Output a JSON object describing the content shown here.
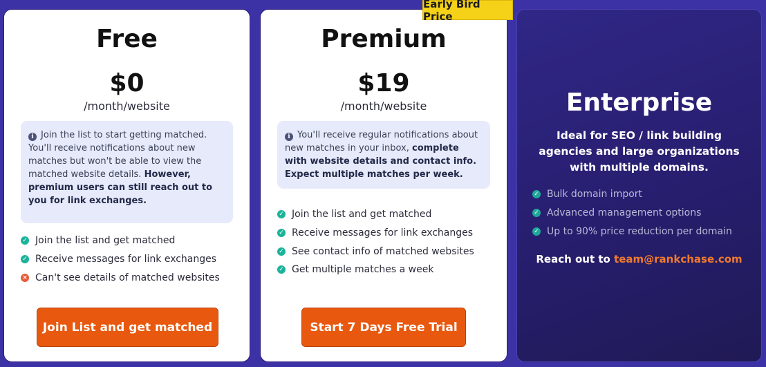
{
  "free": {
    "title": "Free",
    "price": "$0",
    "period": "/month/website",
    "info_normal": "Join the list to start getting matched. You'll receive notifications about new matches but won't be able to view the matched website details. ",
    "info_bold": "However, premium users can still reach out to you for link exchanges.",
    "features": [
      {
        "label": "Join the list and get matched",
        "status": "check"
      },
      {
        "label": "Receive messages for link exchanges",
        "status": "check"
      },
      {
        "label": "Can't see details of matched websites",
        "status": "cross"
      }
    ],
    "cta": "Join List and get matched"
  },
  "premium": {
    "badge": "Early Bird Price",
    "title": "Premium",
    "price": "$19",
    "period": "/month/website",
    "info_normal": "You'll receive regular notifications about new matches in your inbox, ",
    "info_bold": "complete with website details and contact info. Expect multiple matches per week.",
    "features": [
      {
        "label": "Join the list and get matched",
        "status": "check"
      },
      {
        "label": "Receive messages for link exchanges",
        "status": "check"
      },
      {
        "label": "See contact info of matched websites",
        "status": "check"
      },
      {
        "label": "Get multiple matches a week",
        "status": "check"
      }
    ],
    "cta": "Start 7 Days Free Trial"
  },
  "enterprise": {
    "title": "Enterprise",
    "description": "Ideal for SEO / link building agencies and large organizations with multiple domains.",
    "features": [
      {
        "label": "Bulk domain import",
        "status": "check"
      },
      {
        "label": "Advanced management options",
        "status": "check"
      },
      {
        "label": "Up to 90% price reduction per domain",
        "status": "check"
      }
    ],
    "contact_prefix": "Reach out to ",
    "contact_email": "team@rankchase.com"
  },
  "colors": {
    "background": "#3d31a6",
    "cta": "#e8590f",
    "badge": "#f5d217",
    "check": "#1bb39a",
    "cross": "#e85a3a",
    "email": "#f07a2e"
  }
}
